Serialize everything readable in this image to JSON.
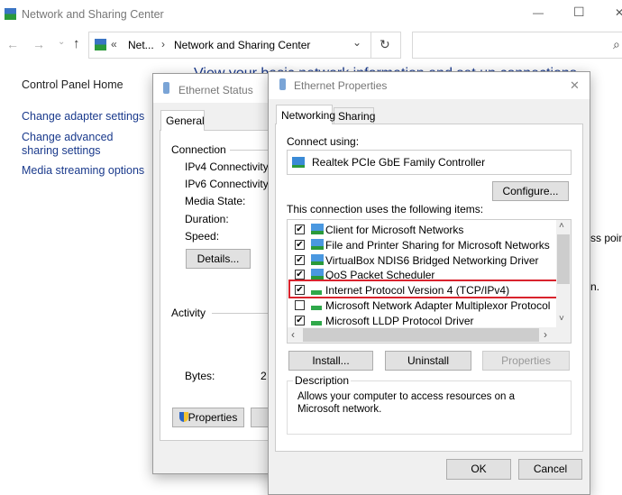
{
  "window": {
    "title": "Network and Sharing Center",
    "minimize": "—",
    "maximize": "☐",
    "close": "✕"
  },
  "address": {
    "overflow": "«",
    "crumb1": "Net...",
    "sep": "›",
    "crumb2": "Network and Sharing Center",
    "dropdown": "⌄",
    "refresh": "↻",
    "search_placeholder": "",
    "search_icon": "⌕"
  },
  "nav": {
    "back": "←",
    "forward": "→",
    "recent": "⌄",
    "up": "↑"
  },
  "sidebar": {
    "items": [
      {
        "label": "Control Panel Home"
      },
      {
        "label": "Change adapter settings"
      },
      {
        "label": "Change advanced sharing settings"
      },
      {
        "label": "Media streaming options"
      }
    ]
  },
  "main": {
    "heading": "View your basic network information and set up connections",
    "right_text1": "ss poin",
    "right_text2": "n."
  },
  "status_dialog": {
    "title": "Ethernet Status",
    "tab": "General",
    "connection_label": "Connection",
    "fields": [
      "IPv4 Connectivity:",
      "IPv6 Connectivity:",
      "Media State:",
      "Duration:",
      "Speed:"
    ],
    "details_button": "Details...",
    "activity_label": "Activity",
    "bytes_label": "Bytes:",
    "bytes_value": "2",
    "properties_button": "Properties"
  },
  "props_dialog": {
    "title": "Ethernet Properties",
    "close": "✕",
    "tabs": [
      {
        "label": "Networking"
      },
      {
        "label": "Sharing"
      }
    ],
    "connect_using": "Connect using:",
    "adapter": "Realtek PCIe GbE Family Controller",
    "configure_button": "Configure...",
    "items_label": "This connection uses the following items:",
    "items": [
      {
        "label": "Client for Microsoft Networks",
        "checked": true,
        "icon": "network-client-icon"
      },
      {
        "label": "File and Printer Sharing for Microsoft Networks",
        "checked": true,
        "icon": "network-service-icon"
      },
      {
        "label": "VirtualBox NDIS6 Bridged Networking Driver",
        "checked": true,
        "icon": "network-service-icon"
      },
      {
        "label": "QoS Packet Scheduler",
        "checked": true,
        "icon": "network-service-icon"
      },
      {
        "label": "Internet Protocol Version 4 (TCP/IPv4)",
        "checked": true,
        "icon": "protocol-icon",
        "highlighted": true
      },
      {
        "label": "Microsoft Network Adapter Multiplexor Protocol",
        "checked": false,
        "icon": "protocol-icon"
      },
      {
        "label": "Microsoft LLDP Protocol Driver",
        "checked": true,
        "icon": "protocol-icon"
      }
    ],
    "install_button": "Install...",
    "uninstall_button": "Uninstall",
    "properties_button": "Properties",
    "description_label": "Description",
    "description": "Allows your computer to access resources on a Microsoft network.",
    "ok_button": "OK",
    "cancel_button": "Cancel"
  },
  "colors": {
    "link": "#1a3a8c",
    "highlight": "#d9232d"
  }
}
